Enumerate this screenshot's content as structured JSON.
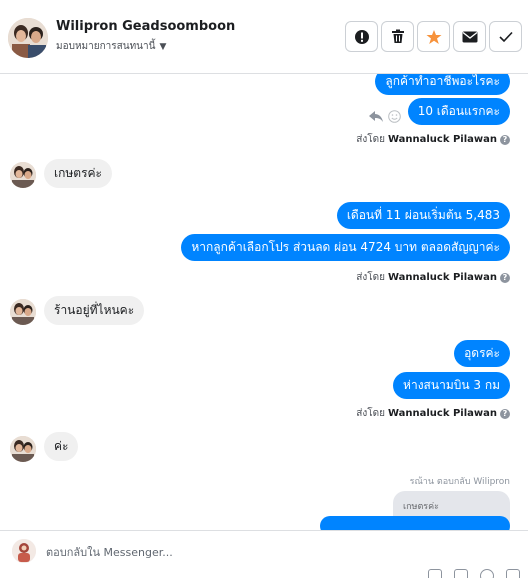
{
  "header": {
    "name": "Wilipron Geadsoomboon",
    "assign_label": "มอบหมายการสนทนานี้",
    "tools": [
      "report-icon",
      "trash-icon",
      "star-icon",
      "envelope-icon",
      "check-icon"
    ],
    "star_color": "#f7923b"
  },
  "thread": {
    "out_msg_1": "ลูกค้าทำอาชีพอะไรคะ",
    "out_msg_2": "10 เดือนแรกคะ",
    "sent_prefix": "ส่งโดย",
    "sender": "Wannaluck Pilawan",
    "in_msg_1": "เกษตรค่ะ",
    "out_msg_3": "เดือนที่ 11  ผ่อนเริ่มต้น 5,483",
    "out_msg_4": "หากลูกค้าเลือกโปร ส่วนลด  ผ่อน 4724  บาท ตลอดสัญญาค่ะ",
    "in_msg_2": "ร้านอยู่ที่ไหนคะ",
    "out_msg_5": "อุดรค่ะ",
    "out_msg_6": "ห่างสนามบิน 3 กม",
    "in_msg_3": "ค่ะ",
    "reply_note": "รณ้าน ตอบกลับ Wilipron",
    "quoted_text": "เกษตรค่ะ",
    "bubble_color": "#0084ff"
  },
  "composer": {
    "placeholder": "ตอบกลับใน Messenger..."
  }
}
